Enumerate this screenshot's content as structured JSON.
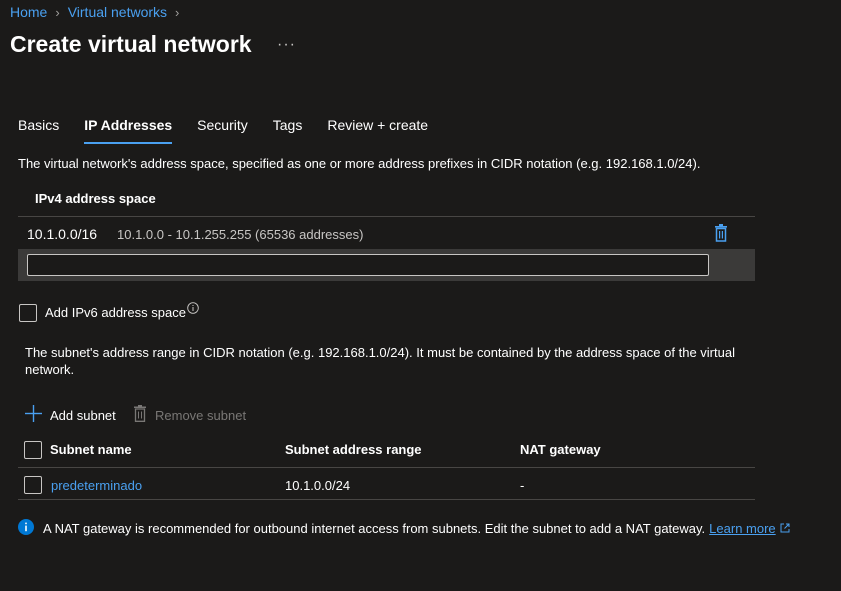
{
  "breadcrumb": {
    "home": "Home",
    "virtual_networks": "Virtual networks"
  },
  "title": "Create virtual network",
  "more": "···",
  "tabs": [
    "Basics",
    "IP Addresses",
    "Security",
    "Tags",
    "Review + create"
  ],
  "active_tab": "IP Addresses",
  "address_space": {
    "description": "The virtual network's address space, specified as one or more address prefixes in CIDR notation (e.g. 192.168.1.0/24).",
    "header": "IPv4 address space",
    "rows": [
      {
        "cidr": "10.1.0.0/16",
        "range": "10.1.0.0 - 10.1.255.255 (65536 addresses)"
      }
    ],
    "new_value": ""
  },
  "ipv6": {
    "label": "Add IPv6 address space",
    "checked": false
  },
  "subnets": {
    "description": "The subnet's address range in CIDR notation (e.g. 192.168.1.0/24). It must be contained by the address space of the virtual network.",
    "add_label": "Add subnet",
    "remove_label": "Remove subnet",
    "columns": [
      "Subnet name",
      "Subnet address range",
      "NAT gateway"
    ],
    "rows": [
      {
        "name": "predeterminado",
        "range": "10.1.0.0/24",
        "nat": "-"
      }
    ]
  },
  "info": {
    "text": "A NAT gateway is recommended for outbound internet access from subnets. Edit the subnet to add a NAT gateway.",
    "link": "Learn more"
  },
  "colors": {
    "accent": "#4aa0f0",
    "background": "#1b1a19",
    "info_icon": "#0078d4"
  }
}
